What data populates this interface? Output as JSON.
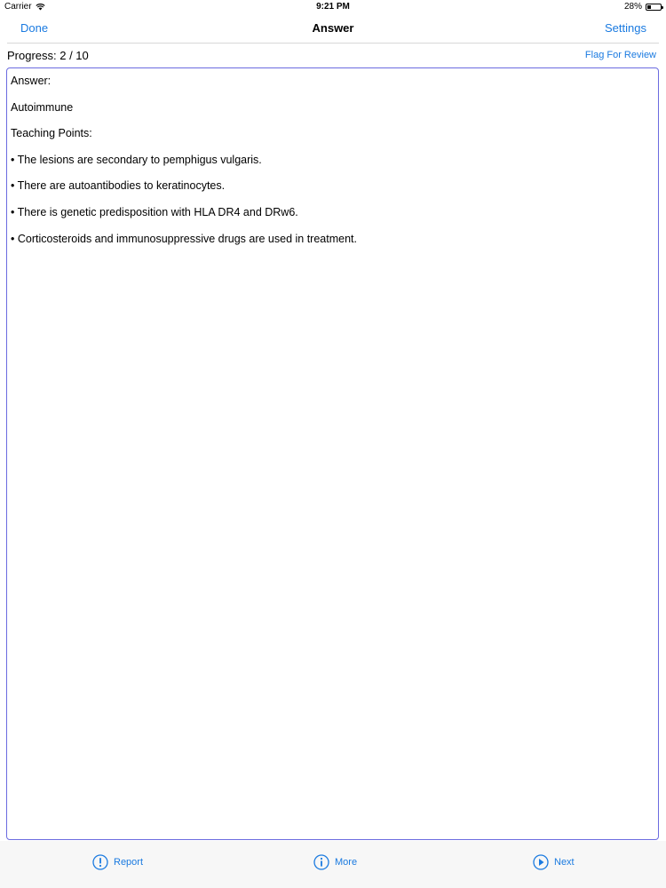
{
  "status_bar": {
    "carrier": "Carrier",
    "time": "9:21 PM",
    "battery": "28%",
    "battery_level": 0.28
  },
  "nav": {
    "left": "Done",
    "title": "Answer",
    "right": "Settings"
  },
  "progress": {
    "text": "Progress: 2 / 10",
    "flag_label": "Flag For Review"
  },
  "content": {
    "heading": "Answer:",
    "answer": "Autoimmune",
    "points_heading": "Teaching Points:",
    "points": [
      "• The lesions are secondary to pemphigus vulgaris.",
      "• There are autoantibodies to keratinocytes.",
      "• There is genetic predisposition with HLA DR4 and DRw6.",
      "• Corticosteroids and immunosuppressive drugs are used in treatment."
    ]
  },
  "toolbar": {
    "report": "Report",
    "more": "More",
    "next": "Next"
  },
  "colors": {
    "accent": "#1a7ae0",
    "border": "#6b6be0"
  }
}
